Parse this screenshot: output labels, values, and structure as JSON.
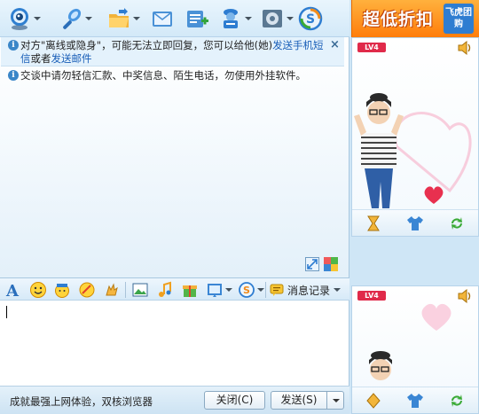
{
  "toolbar": {
    "items": [
      {
        "name": "video-call",
        "icon": "webcam-icon",
        "has_menu": true
      },
      {
        "name": "voice-call",
        "icon": "microphone-icon",
        "has_menu": true
      },
      {
        "name": "send-file",
        "icon": "folder-icon",
        "has_menu": true
      },
      {
        "name": "send-email",
        "icon": "mail-icon",
        "has_menu": false
      },
      {
        "name": "create-group",
        "icon": "add-contact-icon",
        "has_menu": false
      },
      {
        "name": "app-services",
        "icon": "user-card-icon",
        "has_menu": true
      },
      {
        "name": "settings",
        "icon": "gear-icon",
        "has_menu": true
      },
      {
        "name": "soso",
        "icon": "soso-s-icon",
        "has_menu": false
      }
    ]
  },
  "notice": {
    "prefix": "对方\"离线或隐身\"，可能无法立即回复，您可以给他(她)",
    "link1": "发送手机短信",
    "mid": "或者",
    "link2": "发送邮件",
    "close": "×"
  },
  "warning": {
    "text": "交谈中请勿轻信汇款、中奖信息、陌生电话，勿使用外挂软件。"
  },
  "format_bar": {
    "items": [
      "font-icon",
      "emoticon-icon",
      "magic-face-icon",
      "doodle-icon",
      "nudge-icon",
      "screenshot-icon",
      "music-icon",
      "gift-icon",
      "image-icon",
      "soso-icon"
    ],
    "record_label": "消息记录"
  },
  "input": {
    "value": ""
  },
  "bottom": {
    "ad_text": "成就最强上网体验，双核浏览器",
    "close_label": "关闭(C)",
    "send_label": "发送(S)"
  },
  "ad_banner": {
    "main": "超低折扣",
    "tag": "飞虎团购"
  },
  "show_top": {
    "level": "LV4"
  },
  "show_bottom": {
    "level": "LV4"
  },
  "colors": {
    "toolbar_bg": "#d3e9f8",
    "link": "#1a5fb8",
    "ad_orange": "#ff8a12",
    "accent_blue": "#2e7dd1"
  }
}
